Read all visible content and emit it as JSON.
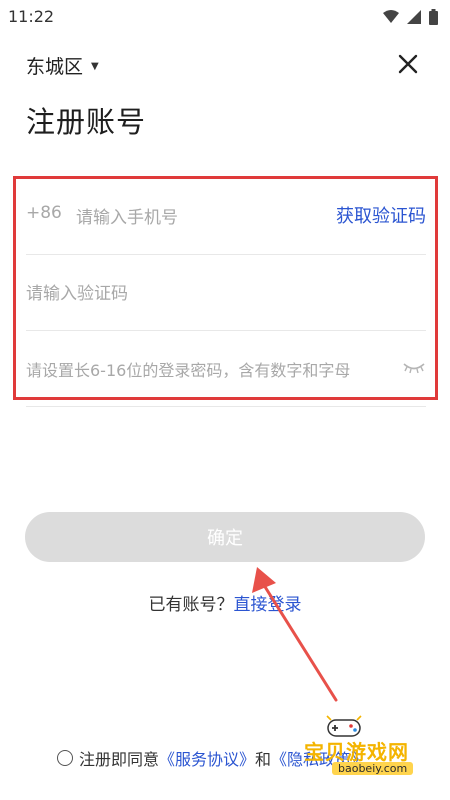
{
  "status_bar": {
    "time": "11:22",
    "icons": [
      "wifi-icon",
      "signal-icon",
      "battery-icon"
    ]
  },
  "header": {
    "district": "东城区",
    "title": "注册账号"
  },
  "form": {
    "country_code": "+86",
    "phone_placeholder": "请输入手机号",
    "get_code_label": "获取验证码",
    "code_placeholder": "请输入验证码",
    "password_placeholder": "请设置长6-16位的登录密码，含有数字和字母"
  },
  "confirm_label": "确定",
  "login": {
    "prompt": "已有账号？",
    "link": "直接登录"
  },
  "agreement": {
    "prefix": "注册即同意",
    "service_link": "《服务协议》",
    "and": "和",
    "privacy_link": "《隐私政策》"
  },
  "watermark": {
    "text": "宝贝游戏网",
    "sub": "baobeiy.com"
  },
  "colors": {
    "accent": "#2b55d1",
    "highlight": "#e03a3a",
    "button_disabled": "#dcdcdc"
  }
}
